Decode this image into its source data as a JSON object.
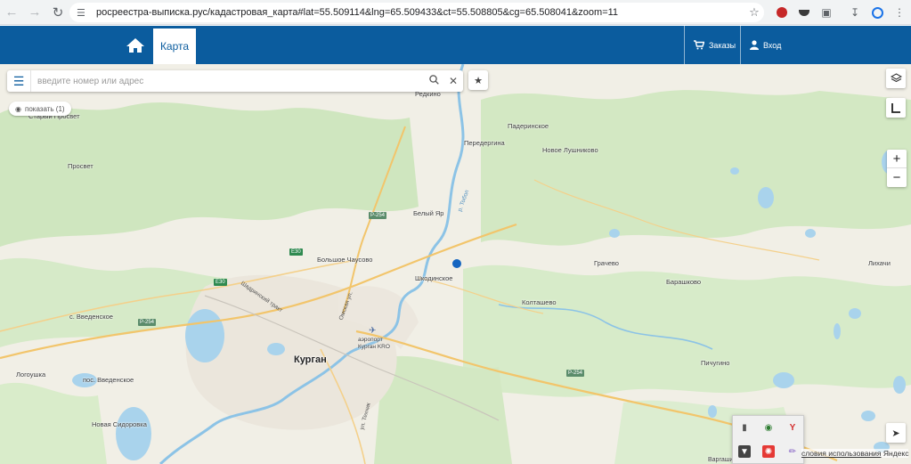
{
  "browser": {
    "url": "росреестра-выписка.рус/кадастровая_карта#lat=55.509114&lng=65.509433&ct=55.508805&cg=65.508041&zoom=11",
    "icons": [
      "back-icon",
      "forward-icon",
      "reload-icon",
      "site-info-icon",
      "bookmark-star-icon",
      "extension-icon",
      "download-icon",
      "profile-icon",
      "menu-kebab-icon"
    ]
  },
  "header": {
    "map_tab_label": "Карта",
    "orders_label": "Заказы",
    "login_label": "Вход",
    "accent_color": "#0b5c9e"
  },
  "search": {
    "placeholder": "введите номер или адрес"
  },
  "show_button": {
    "label": "показать (1)"
  },
  "map": {
    "labels": {
      "starly_prosvet": "Старый Просвет",
      "prosvet": "Просвет",
      "redkino": "Редкино",
      "paderinskoe": "Падеринское",
      "peredergina": "Передергина",
      "novoe_lushnikovo": "Новое Лушниково",
      "bely_yar": "Белый Яр",
      "bolshoe_chausovo": "Большое Чаусово",
      "shkodinskoe": "Шкодинское",
      "grachevo": "Грачево",
      "barashkovo": "Барашково",
      "likhachi": "Лихачи",
      "koltashevo": "Колташево",
      "s_vvedenskoe": "с. Введенское",
      "kurgan": "Курган",
      "logoushka": "Логоушка",
      "pos_vvedenskoe": "пос. Введенское",
      "pichugino": "Пичугино",
      "novaya_sidorovka": "Новая Сидоровка",
      "airport": "аэропорт Курган KRO",
      "vargashi": "Варгаши",
      "shadrinsky_trakt": "Шадринский тракт",
      "omskaya_ul": "Омская ул.",
      "r_tobol": "р. Тобол",
      "ul_tekhnik": "ул. Техник"
    },
    "roads": {
      "p254_a": "Р-254",
      "p254_b": "Р-254",
      "p254_c": "Р-254",
      "e30_a": "E30",
      "e30_b": "E30"
    },
    "terms_text": "словия использования",
    "yandex_text": "Яндекс"
  }
}
